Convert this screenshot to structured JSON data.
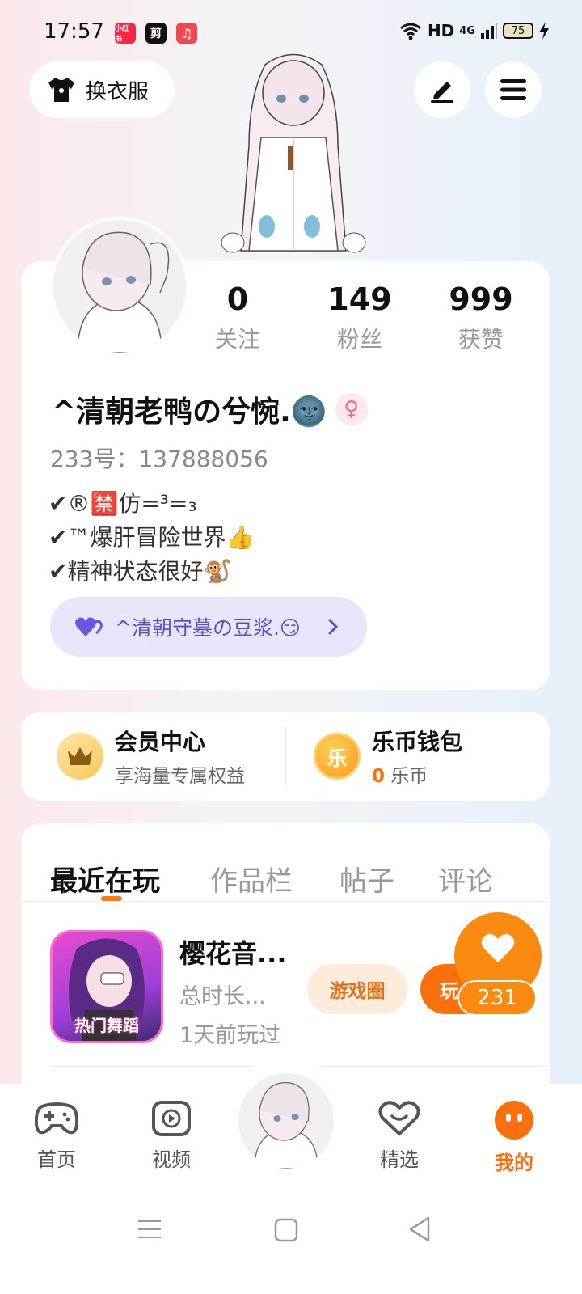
{
  "status_bar": {
    "time": "17:57",
    "app_badges": [
      {
        "label": "小红书",
        "color": "#ff2442"
      },
      {
        "label": "剪",
        "color": "#111111"
      },
      {
        "label": "♫",
        "color": "#f0484d"
      }
    ],
    "network": "HD",
    "signal": "4G",
    "battery": "75"
  },
  "header": {
    "outfit_label": "换衣服",
    "edit_icon": "pen-icon",
    "menu_icon": "menu-icon"
  },
  "profile": {
    "stats": [
      {
        "value": "0",
        "label": "关注"
      },
      {
        "value": "149",
        "label": "粉丝"
      },
      {
        "value": "999",
        "label": "获赞"
      }
    ],
    "nickname": "^清朝老鸭の兮惋.🌚",
    "gender_symbol": "♀",
    "uid": "233号：137888056",
    "bio_lines": [
      "✔®🈲仿=³=₃",
      "✔™爆肝冒险世界👍",
      "✔精神状态很好🐒"
    ],
    "partner": {
      "label": "^清朝守墓の豆浆.😏",
      "icon": "heart-icon"
    }
  },
  "membership": {
    "vip": {
      "title": "会员中心",
      "subtitle": "享海量专属权益"
    },
    "wallet": {
      "title": "乐币钱包",
      "amount": "0",
      "unit": "乐币",
      "coin_glyph": "乐"
    }
  },
  "tabs": [
    "最近在玩",
    "作品栏",
    "帖子",
    "评论"
  ],
  "recent_game": {
    "name": "樱花音...",
    "playtime": "总时长...",
    "last_played": "1天前玩过",
    "icon_caption": "热门舞蹈",
    "circle_button": "游戏圈",
    "play_button": "玩"
  },
  "like_fab": {
    "count": "231"
  },
  "bottom_nav": [
    {
      "label": "首页",
      "icon": "gamepad-icon"
    },
    {
      "label": "视频",
      "icon": "video-icon"
    },
    {
      "label": "精选",
      "icon": "heart-badge-icon"
    },
    {
      "label": "我的",
      "icon": "me-icon"
    }
  ],
  "colors": {
    "accent": "#fb6f0d",
    "partner_bg": "#e9e6fb",
    "partner_text": "#5b4fc9"
  }
}
